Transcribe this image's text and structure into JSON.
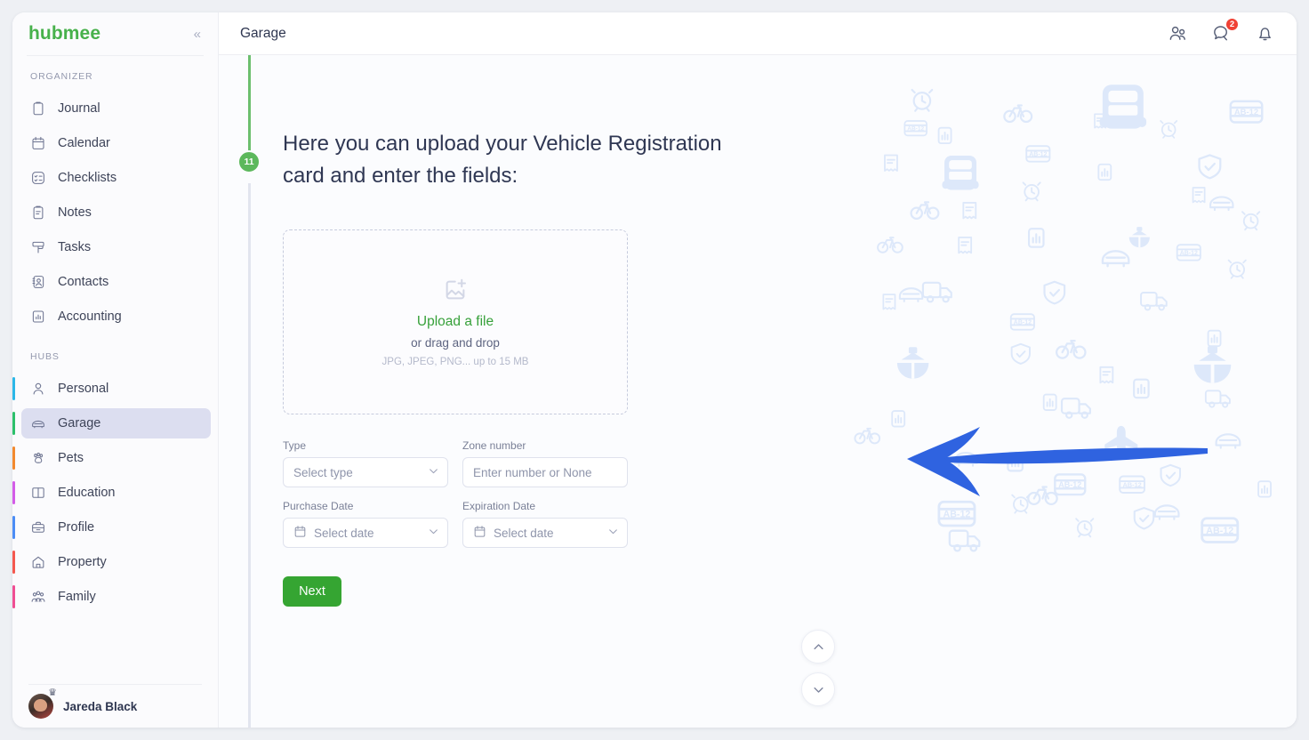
{
  "brand": {
    "name": "hubmee",
    "collapse_icon": "double-chevron-left"
  },
  "sidebar": {
    "organizer_label": "ORGANIZER",
    "organizer_items": [
      {
        "label": "Journal",
        "icon": "clipboard-icon"
      },
      {
        "label": "Calendar",
        "icon": "calendar-icon"
      },
      {
        "label": "Checklists",
        "icon": "checklist-icon"
      },
      {
        "label": "Notes",
        "icon": "notes-icon"
      },
      {
        "label": "Tasks",
        "icon": "tasks-icon"
      },
      {
        "label": "Contacts",
        "icon": "contacts-icon"
      },
      {
        "label": "Accounting",
        "icon": "accounting-chart-icon"
      }
    ],
    "hubs_label": "HUBS",
    "hub_items": [
      {
        "label": "Personal",
        "icon": "person-icon",
        "accent": "#2bb7e8",
        "selected": false
      },
      {
        "label": "Garage",
        "icon": "car-icon",
        "accent": "#2cc06b",
        "selected": true
      },
      {
        "label": "Pets",
        "icon": "paw-icon",
        "accent": "#f2892f",
        "selected": false
      },
      {
        "label": "Education",
        "icon": "book-icon",
        "accent": "#d35ce8",
        "selected": false
      },
      {
        "label": "Profile",
        "icon": "briefcase-icon",
        "accent": "#4b8cf5",
        "selected": false
      },
      {
        "label": "Property",
        "icon": "home-icon",
        "accent": "#f4584f",
        "selected": false
      },
      {
        "label": "Family",
        "icon": "family-icon",
        "accent": "#ef4e93",
        "selected": false
      }
    ],
    "user": {
      "name": "Jareda Black",
      "badge_icon": "crown-icon"
    }
  },
  "topbar": {
    "title": "Garage",
    "icons": [
      {
        "name": "users-icon",
        "badge": null
      },
      {
        "name": "chat-icon",
        "badge": "2"
      },
      {
        "name": "bell-icon",
        "badge": null
      }
    ]
  },
  "timeline": {
    "step_badge": "11"
  },
  "main": {
    "headline": "Here you can upload your Vehicle Registration card and enter the fields:",
    "dropzone": {
      "icon": "image-add-icon",
      "link": "Upload a file",
      "sub": "or drag and drop",
      "hint": "JPG, JPEG, PNG... up to 15 MB"
    },
    "fields": [
      {
        "label": "Type",
        "value": "Select type",
        "icon": null,
        "chevron": true,
        "name": "type-select"
      },
      {
        "label": "Zone number",
        "value": "Enter number or None",
        "icon": null,
        "chevron": false,
        "name": "zone-number-input"
      },
      {
        "label": "Purchase Date",
        "value": "Select date",
        "icon": "calendar-icon",
        "chevron": true,
        "name": "purchase-date-picker"
      },
      {
        "label": "Expiration Date",
        "value": "Select date",
        "icon": "calendar-icon",
        "chevron": true,
        "name": "expiration-date-picker"
      }
    ],
    "next_label": "Next",
    "scroll_up_icon": "chevron-up-icon",
    "scroll_down_icon": "chevron-down-icon",
    "annotation_arrow": "blue-arrow-pointing-left",
    "background_plate_text": "AB-12"
  },
  "colors": {
    "brand_green": "#47b14b",
    "button_green": "#35a532",
    "badge_red": "#f04134",
    "selected_bg": "#dcdef0",
    "watermark_blue": "#dde8fa",
    "arrow_blue": "#2f63e0"
  }
}
